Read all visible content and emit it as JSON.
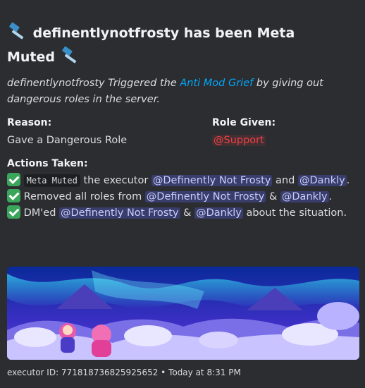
{
  "embed": {
    "title_main": "definentlynotfrosty has been Meta",
    "title_end": "Muted",
    "description": {
      "prefix": "definentlynotfrosty Triggered the ",
      "link": "Anti Mod Grief",
      "suffix": " by giving out dangerous roles in the server."
    },
    "fields": [
      {
        "name": "Reason:",
        "value": "Gave a Dangerous Role"
      },
      {
        "name": "Role Given:",
        "value": "@Support"
      }
    ],
    "actions": {
      "heading": "Actions Taken:",
      "line1": {
        "code": "Meta Muted",
        "text_a": " the executor ",
        "mention_a": "@Definently Not Frosty",
        "text_b": " and ",
        "mention_b": "@Dankly",
        "text_end": "."
      },
      "line2": {
        "text_a": " Removed all roles from ",
        "mention_a": "@Definently Not Frosty",
        "text_b": " & ",
        "mention_b": "@Dankly",
        "text_end": "."
      },
      "line3": {
        "text_a": " DM'ed ",
        "mention_a": "@Definently Not Frosty",
        "text_b": " & ",
        "mention_b": "@Dankly",
        "text_end": " about the situation."
      }
    },
    "footer": "executor ID: 771818736825925652 • Today at 8:31 PM"
  },
  "colors": {
    "background": "#2b2d31",
    "link": "#00a8fc",
    "role_red": "#f23f42",
    "mention_bg": "#5865f2",
    "check_green": "#3ba55c"
  },
  "icons": [
    "hammer-icon",
    "check-icon"
  ]
}
